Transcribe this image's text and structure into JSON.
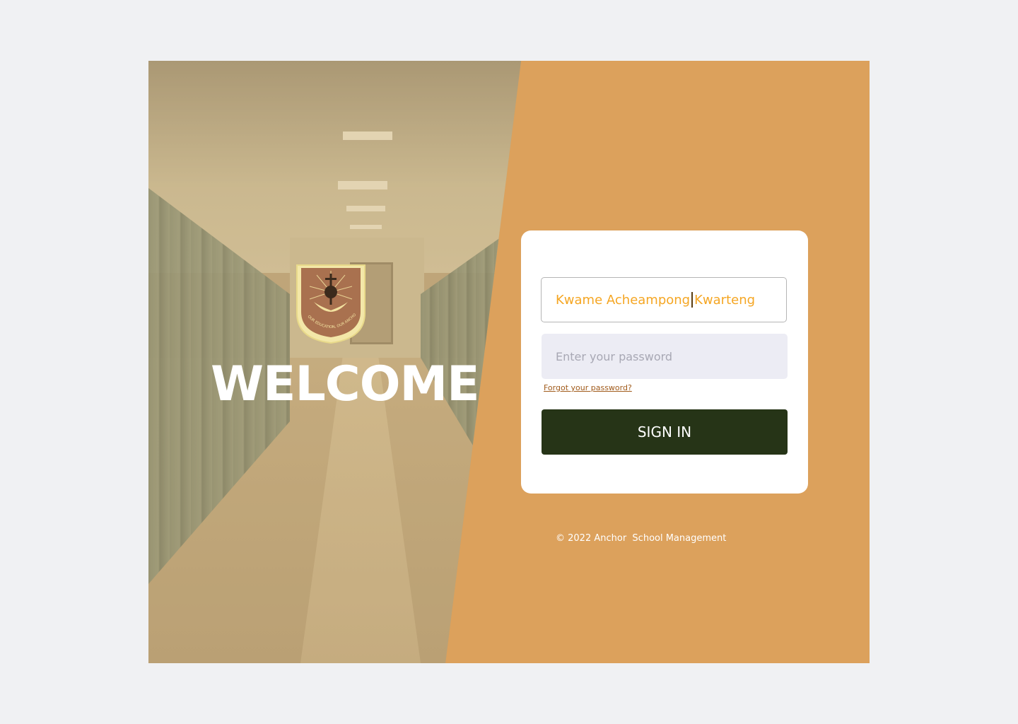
{
  "hero": {
    "welcome": "WELCOME",
    "crest_icon": "school-crest-logo",
    "crest_motto": "OUR EDUCATION, OUR ANCHOR, OUR FUTURE"
  },
  "login": {
    "username_before_caret": "Kwame Acheampong",
    "username_after_caret": "Kwarteng",
    "password_placeholder": "Enter your password",
    "forgot_label": "Forgot your password?",
    "signin_label": "SIGN IN"
  },
  "footer": {
    "copyright": "© 2022 Anchor  School Management"
  },
  "colors": {
    "page_bg": "#f0f1f3",
    "accent_panel": "#dca15c",
    "signin_bg": "#263417",
    "username_text": "#f5a623",
    "password_bg": "#ececf4",
    "forgot_link": "#a05a1a"
  }
}
